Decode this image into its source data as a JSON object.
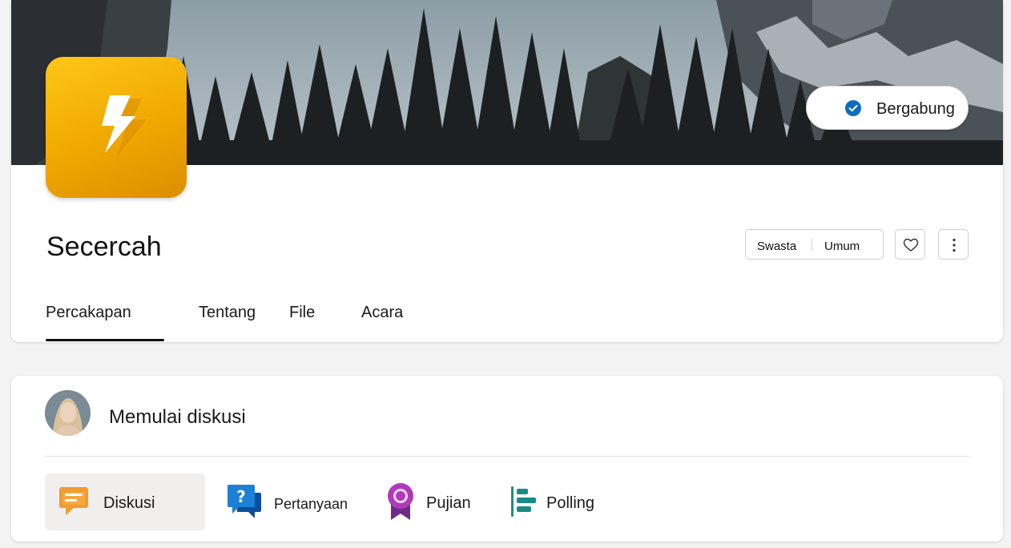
{
  "header": {
    "join_button_label": "Bergabung",
    "group_name": "Secercah",
    "visibility": {
      "option_private": "Swasta",
      "option_public": "Umum"
    }
  },
  "tabs": [
    {
      "label": "Percakapan",
      "selected": true
    },
    {
      "label": "Tentang",
      "selected": false
    },
    {
      "label": "File",
      "selected": false
    },
    {
      "label": "Acara",
      "selected": false
    }
  ],
  "composer": {
    "prompt": "Memulai diskusi",
    "types": [
      {
        "label": "Diskusi",
        "icon": "discussion-icon",
        "selected": true
      },
      {
        "label": "Pertanyaan",
        "icon": "question-icon",
        "selected": false
      },
      {
        "label": "Pujian",
        "icon": "praise-icon",
        "selected": false
      },
      {
        "label": "Polling",
        "icon": "poll-icon",
        "selected": false
      }
    ]
  },
  "colors": {
    "accent": "#0f6cbd",
    "logo_yellow": "#f0a800",
    "discussion_orange": "#f7a13a",
    "question_blue": "#1e7fd6",
    "praise_purple": "#b03ab8",
    "poll_teal": "#1a8a86"
  }
}
